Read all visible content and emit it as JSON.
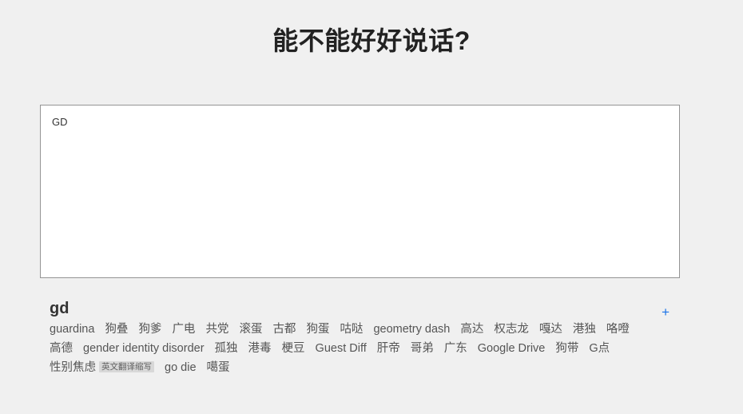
{
  "page": {
    "title": "能不能好好说话?",
    "background_color": "#f0f0f0"
  },
  "input": {
    "value": "GD",
    "placeholder": ""
  },
  "results": {
    "term": "gd",
    "add_icon": "+",
    "accent_color": "#1a73e8",
    "tags": [
      {
        "label": "guardina"
      },
      {
        "label": "狗叠"
      },
      {
        "label": "狗爹"
      },
      {
        "label": "广电"
      },
      {
        "label": "共党"
      },
      {
        "label": "滚蛋"
      },
      {
        "label": "古都"
      },
      {
        "label": "狗蛋"
      },
      {
        "label": "咕哒"
      },
      {
        "label": "geometry dash"
      },
      {
        "label": "高达"
      },
      {
        "label": "权志龙"
      },
      {
        "label": "嘎达"
      },
      {
        "label": "港独"
      },
      {
        "label": "咯噔"
      },
      {
        "label": "高德"
      },
      {
        "label": "gender identity disorder"
      },
      {
        "label": "孤独"
      },
      {
        "label": "港毒"
      },
      {
        "label": "梗豆"
      },
      {
        "label": "Guest Diff"
      },
      {
        "label": "肝帝"
      },
      {
        "label": "哥弟"
      },
      {
        "label": "广东"
      },
      {
        "label": "Google Drive"
      },
      {
        "label": "狗带"
      },
      {
        "label": "G点"
      },
      {
        "label": "性别焦虑",
        "badge": "英文翻译缩写"
      },
      {
        "label": "go die"
      },
      {
        "label": "噶蛋"
      }
    ]
  }
}
